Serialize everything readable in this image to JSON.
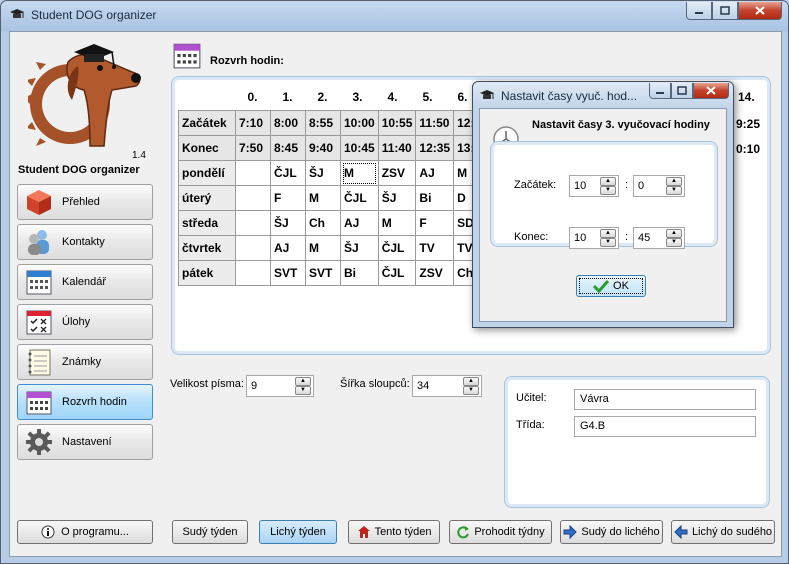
{
  "window": {
    "title": "Student DOG organizer"
  },
  "sidebar": {
    "version": "1.4",
    "app_name": "Student DOG organizer",
    "items": [
      {
        "label": "Přehled",
        "icon": "cube-icon"
      },
      {
        "label": "Kontakty",
        "icon": "people-icon"
      },
      {
        "label": "Kalendář",
        "icon": "calendar-icon"
      },
      {
        "label": "Úlohy",
        "icon": "checklist-icon"
      },
      {
        "label": "Známky",
        "icon": "notebook-icon"
      },
      {
        "label": "Rozvrh hodin",
        "icon": "timetable-icon",
        "active": true
      },
      {
        "label": "Nastavení",
        "icon": "gear-icon"
      }
    ],
    "about_label": "O programu..."
  },
  "main": {
    "title": "Rozvrh hodin:",
    "columns": [
      "0.",
      "1.",
      "2.",
      "3.",
      "4.",
      "5.",
      "6."
    ],
    "clipped_column": "14.",
    "rows": [
      {
        "label": "Začátek",
        "cells": [
          "7:10",
          "8:00",
          "8:55",
          "10:00",
          "10:55",
          "11:50",
          "12:4"
        ],
        "tail": "9:25"
      },
      {
        "label": "Konec",
        "cells": [
          "7:50",
          "8:45",
          "9:40",
          "10:45",
          "11:40",
          "12:35",
          "13:2"
        ],
        "tail": "0:10"
      },
      {
        "label": "pondělí",
        "cells": [
          "",
          "ČJL",
          "ŠJ",
          "M",
          "ZSV",
          "AJ",
          "M"
        ]
      },
      {
        "label": "úterý",
        "cells": [
          "",
          "F",
          "M",
          "ČJL",
          "ŠJ",
          "Bi",
          "D"
        ]
      },
      {
        "label": "středa",
        "cells": [
          "",
          "ŠJ",
          "Ch",
          "AJ",
          "M",
          "F",
          "SDG"
        ]
      },
      {
        "label": "čtvrtek",
        "cells": [
          "",
          "AJ",
          "M",
          "ŠJ",
          "ČJL",
          "TV",
          "TV"
        ]
      },
      {
        "label": "pátek",
        "cells": [
          "",
          "SVT",
          "SVT",
          "Bi",
          "ČJL",
          "ZSV",
          "Ch"
        ]
      }
    ],
    "font_size_label": "Velikost písma:",
    "font_size_value": "9",
    "col_width_label": "Šířka sloupců:",
    "col_width_value": "34",
    "teacher_label": "Učitel:",
    "teacher_value": "Vávra",
    "class_label": "Třída:",
    "class_value": "G4.B"
  },
  "bottom_buttons": [
    {
      "label": "Sudý týden"
    },
    {
      "label": "Lichý týden",
      "pressed": true
    },
    {
      "label": "Tento týden"
    },
    {
      "label": "Prohodit týdny"
    },
    {
      "label": "Sudý do lichého"
    },
    {
      "label": "Lichý do sudého"
    }
  ],
  "dialog": {
    "title": "Nastavit časy vyuč. hod...",
    "heading": "Nastavit časy 3. vyučovací hodiny",
    "start_label": "Začátek:",
    "start_hour": "10",
    "start_minute": "0",
    "end_label": "Konec:",
    "end_hour": "10",
    "end_minute": "45",
    "separator": ":",
    "ok_label": "OK"
  },
  "colors": {
    "accent": "#3d8fd1",
    "close": "#c4422c",
    "panel_border": "#a8c4df"
  }
}
